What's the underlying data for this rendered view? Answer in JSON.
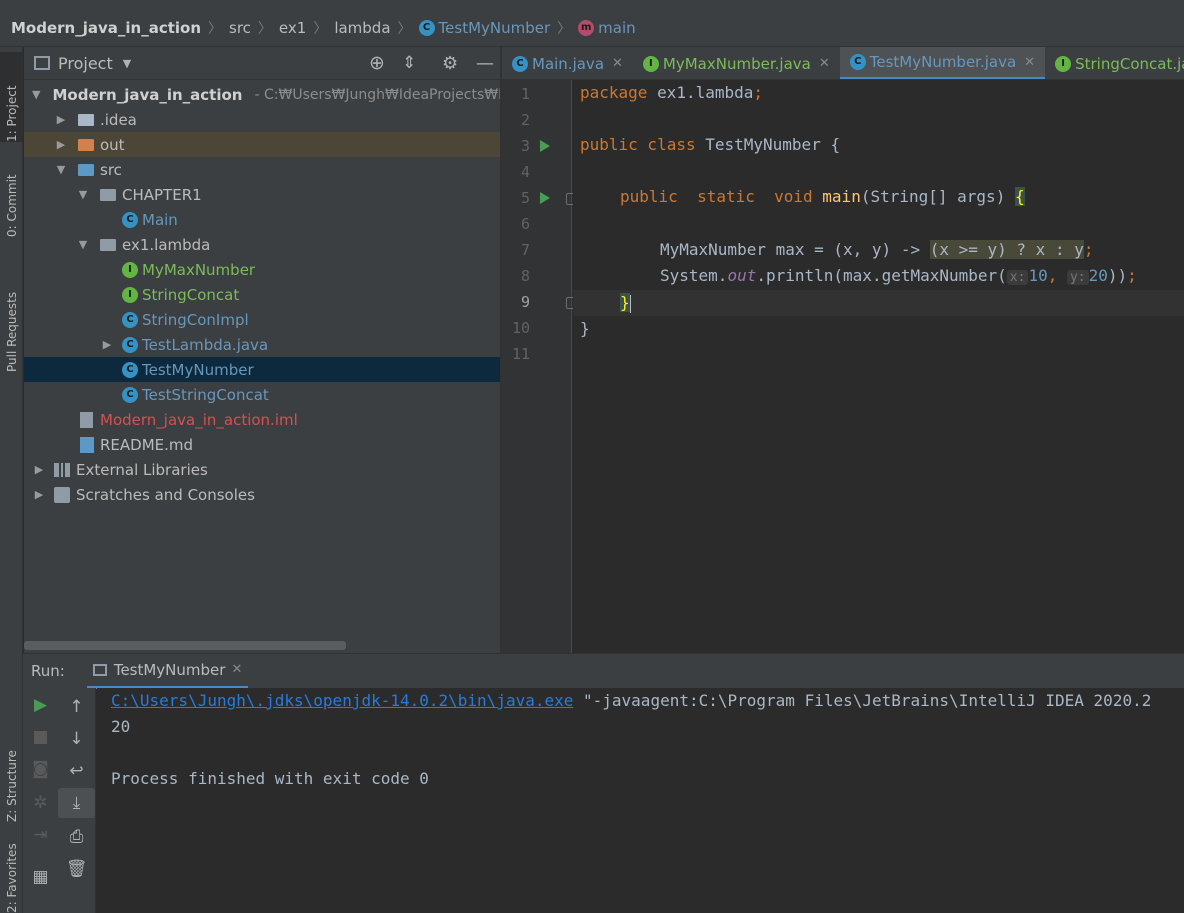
{
  "breadcrumb": {
    "project": "Modern_java_in_action",
    "items": [
      "src",
      "ex1",
      "lambda"
    ],
    "class": "TestMyNumber",
    "method": "main"
  },
  "left_strip": {
    "project_tab": "1: Project",
    "commit_tab": "0: Commit",
    "pull_requests_tab": "Pull Requests",
    "structure_tab": "Z: Structure",
    "favorites_tab": "2: Favorites"
  },
  "project_panel": {
    "title": "Project",
    "root_name": "Modern_java_in_action",
    "root_path": "- C:₩Users₩Jungh₩IdeaProjects₩Moc",
    "tree": [
      {
        "label": ".idea"
      },
      {
        "label": "out"
      },
      {
        "label": "src"
      },
      {
        "label": "CHAPTER1"
      },
      {
        "label": "Main"
      },
      {
        "label": "ex1.lambda"
      },
      {
        "label": "MyMaxNumber"
      },
      {
        "label": "StringConcat"
      },
      {
        "label": "StringConImpl"
      },
      {
        "label": "TestLambda.java"
      },
      {
        "label": "TestMyNumber"
      },
      {
        "label": "TestStringConcat"
      },
      {
        "label": "Modern_java_in_action.iml"
      },
      {
        "label": "README.md"
      },
      {
        "label": "External Libraries"
      },
      {
        "label": "Scratches and Consoles"
      }
    ]
  },
  "editor_tabs": [
    {
      "label": "Main.java"
    },
    {
      "label": "MyMaxNumber.java"
    },
    {
      "label": "TestMyNumber.java"
    },
    {
      "label": "StringConcat.java"
    }
  ],
  "editor": {
    "line_numbers": [
      "1",
      "2",
      "3",
      "4",
      "5",
      "6",
      "7",
      "8",
      "9",
      "10",
      "11"
    ],
    "code": {
      "l1_kw": "package",
      "l1_rest": " ex1.lambda",
      "l1_semi": ";",
      "l3_kw": "public class",
      "l3_rest": " TestMyNumber {",
      "l5_kw1": "public  static  void",
      "l5_fn": " main",
      "l5_rest": "(String[] args) ",
      "l5_brace": "{",
      "l7_pre": "MyMaxNumber max = (x, y) -> ",
      "l7_hl": "(x >= y) ? x : y",
      "l7_semi": ";",
      "l8_pre": "System.",
      "l8_out": "out",
      "l8_mid": ".println(max.getMaxNumber(",
      "l8_hint_x": "x:",
      "l8_num1": "10",
      "l8_comma": ", ",
      "l8_hint_y": "y:",
      "l8_num2": "20",
      "l8_end": "))",
      "l8_semi": ";",
      "l9_brace": "}",
      "l10": "}"
    }
  },
  "run_panel": {
    "label": "Run:",
    "tab": "TestMyNumber",
    "console": {
      "cmd_path": "C:\\Users\\Jungh\\.jdks\\openjdk-14.0.2\\bin\\java.exe",
      "cmd_args": " \"-javaagent:C:\\Program Files\\JetBrains\\IntelliJ IDEA 2020.2",
      "output": "20",
      "finished": "Process finished with exit code 0"
    }
  }
}
